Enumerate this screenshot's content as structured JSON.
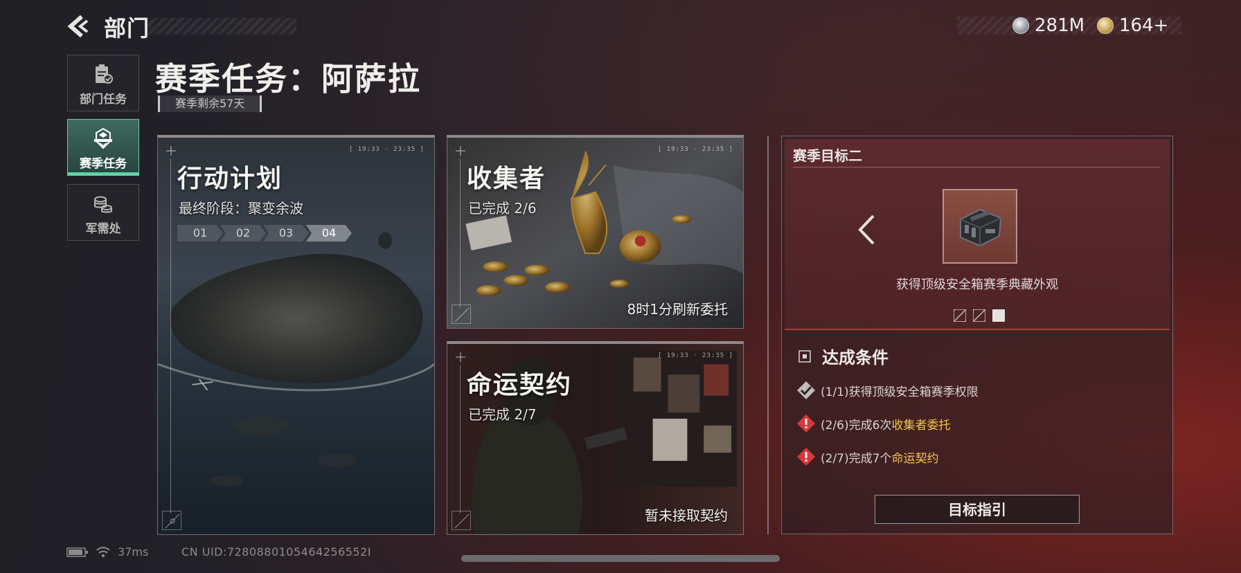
{
  "header": {
    "title": "部门",
    "resources": [
      {
        "icon": "silver-coin-icon",
        "value": "281M"
      },
      {
        "icon": "gold-coin-icon",
        "value": "164+"
      }
    ]
  },
  "sidebar": {
    "items": [
      {
        "label": "部门任务",
        "icon": "clipboard-icon",
        "active": false
      },
      {
        "label": "赛季任务",
        "icon": "season-emblem-icon",
        "active": true
      },
      {
        "label": "军需处",
        "icon": "coins-stack-icon",
        "active": false
      }
    ]
  },
  "main": {
    "title": "赛季任务：阿萨拉",
    "season_remaining": "赛季剩余57天"
  },
  "cards": {
    "operation": {
      "title": "行动计划",
      "subtitle": "最终阶段：聚变余波",
      "stages": [
        "01",
        "02",
        "03",
        "04"
      ],
      "current_stage": "04"
    },
    "collector": {
      "title": "收集者",
      "progress": "已完成 2/6",
      "footer": "8时1分刷新委托"
    },
    "fate": {
      "title": "命运契约",
      "progress": "已完成 2/7",
      "footer": "暂未接取契约"
    }
  },
  "goal_panel": {
    "title": "赛季目标二",
    "reward_icon": "safe-case-icon",
    "reward_desc": "获得顶级安全箱赛季典藏外观",
    "pages": 3,
    "current_page": 3,
    "conditions_title": "达成条件",
    "conditions": [
      {
        "status": "done",
        "prefix": "(1/1)获得顶级安全箱赛季权限",
        "highlight": ""
      },
      {
        "status": "pending",
        "prefix": "(2/6)完成6次",
        "highlight": "收集者委托"
      },
      {
        "status": "pending",
        "prefix": "(2/7)完成7个",
        "highlight": "命运契约"
      }
    ],
    "guide_button": "目标指引"
  },
  "status_bar": {
    "ping": "37ms",
    "uid": "CN UID:7280880105464256552I"
  },
  "colors": {
    "accent_green": "#5fd4a8",
    "highlight_gold": "#f2c84a",
    "warning_red": "#d8383a"
  }
}
